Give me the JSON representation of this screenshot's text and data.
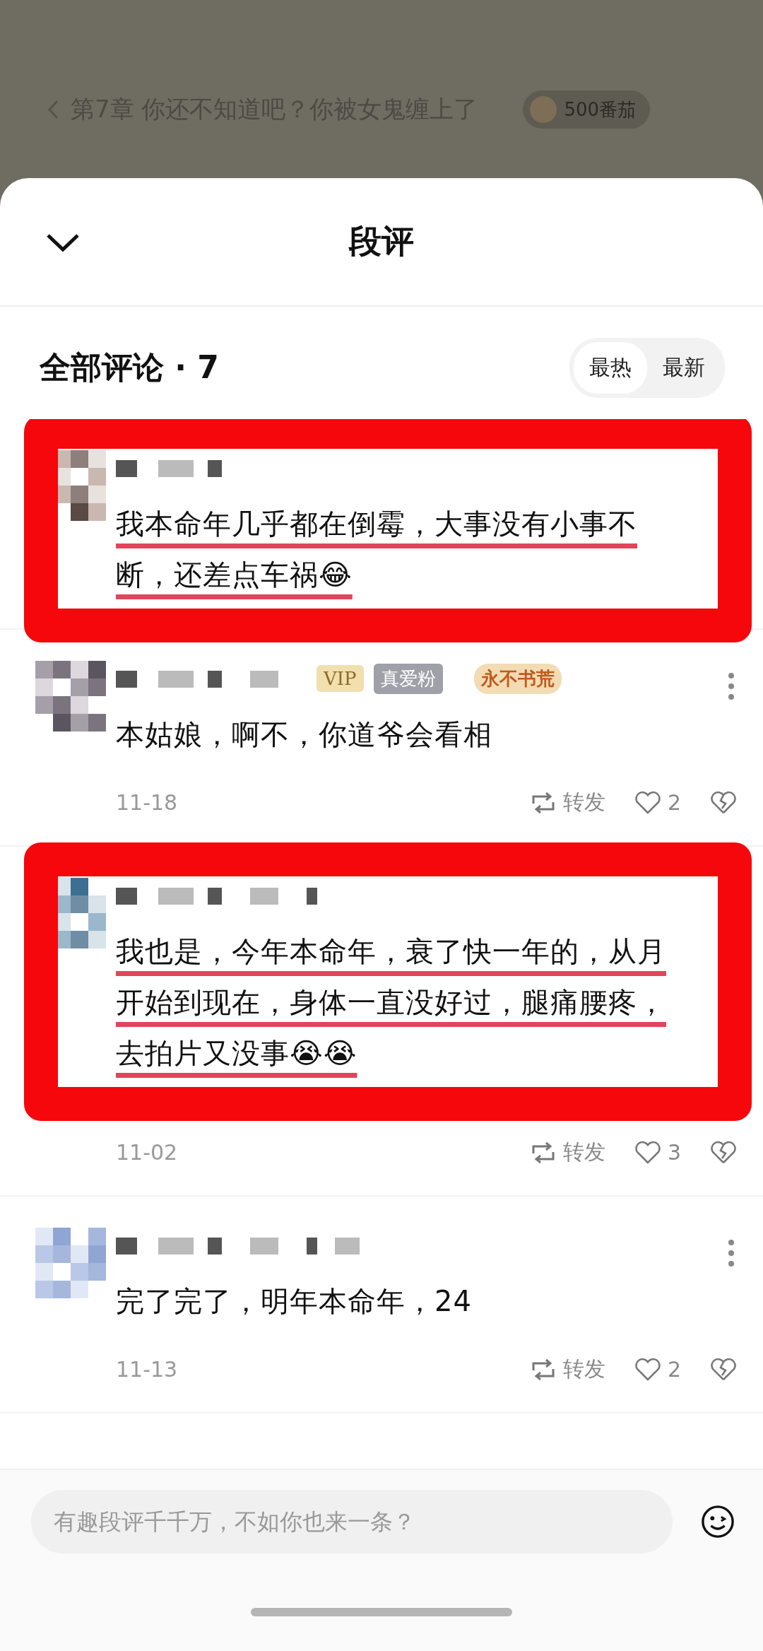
{
  "top_bar": {
    "chapter_title": "第7章 你还不知道吧？你被女鬼缠上了",
    "reward": "500番茄"
  },
  "sheet": {
    "title": "段评"
  },
  "comments_header": {
    "label": "全部评论 · 7",
    "sort_tabs": [
      {
        "label": "最热",
        "selected": true
      },
      {
        "label": "最新",
        "selected": false
      }
    ]
  },
  "comments": [
    {
      "highlighted": true,
      "text": "我本命年几乎都在倒霉，大事没有小事不断，还差点车祸😂"
    },
    {
      "highlighted": false,
      "badges": [
        {
          "label": "VIP",
          "kind": "vip"
        },
        {
          "label": "真爱粉",
          "kind": "fan"
        },
        {
          "label": "永不书荒",
          "kind": "medal"
        }
      ],
      "text": "本姑娘，啊不，你道爷会看相",
      "date": "11-18",
      "repost": "转发",
      "likes": "2"
    },
    {
      "highlighted": true,
      "text": "我也是，今年本命年，衰了快一年的，从月开始到现在，身体一直没好过，腿痛腰疼，去拍片又没事😭😭",
      "date": "11-02",
      "repost": "转发",
      "likes": "3"
    },
    {
      "highlighted": false,
      "text": "完了完了，明年本命年，24",
      "date": "11-13",
      "repost": "转发",
      "likes": "2"
    }
  ],
  "composer": {
    "placeholder": "有趣段评千千万，不如你也来一条？"
  }
}
